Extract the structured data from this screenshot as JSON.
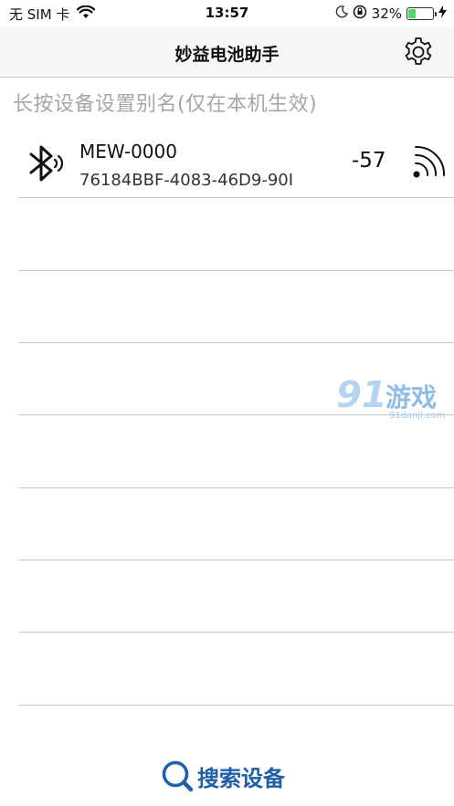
{
  "status_bar": {
    "carrier": "无 SIM 卡",
    "time": "13:57",
    "battery_percent_text": "32%",
    "battery_level": 0.32,
    "battery_color": "#4cd964"
  },
  "nav": {
    "title": "妙益电池助手",
    "settings_icon": "gear-icon"
  },
  "hint": "长按设备设置别名(仅在本机生效)",
  "devices": [
    {
      "name": "MEW-0000",
      "uuid": "76184BBF-4083-46D9-90I",
      "rssi": "-57",
      "icon": "bluetooth-icon",
      "signal_icon": "signal-strength-icon"
    }
  ],
  "watermark": {
    "number": "91",
    "text": "游戏",
    "url": "91danji.com"
  },
  "search_button": {
    "label": "搜索设备",
    "icon": "search-icon",
    "color": "#1e5fa8"
  }
}
